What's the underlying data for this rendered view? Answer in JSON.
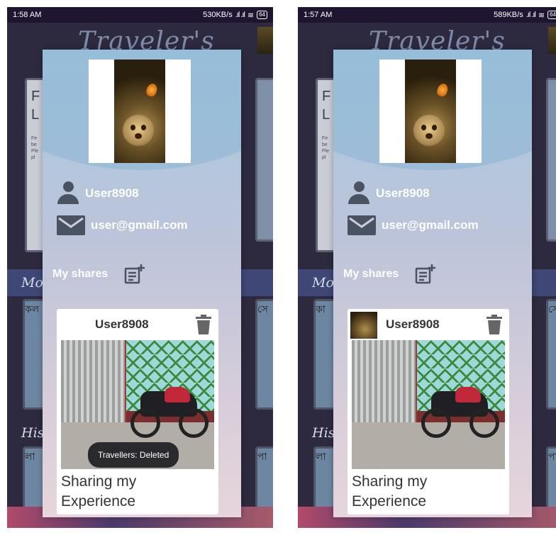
{
  "screens": [
    {
      "status": {
        "time": "1:58 AM",
        "net_speed": "530KB/s",
        "battery": "64"
      },
      "app_title": "Traveler's",
      "background": {
        "card_title": "F\nL",
        "card_text": "Fe\nbe\nPle\npl",
        "section_1": "Mo",
        "section_2": "His",
        "tile_1": "কল",
        "tile_2": "সে",
        "tile_3": "লা",
        "tile_4": "পা"
      },
      "drawer": {
        "username": "User8908",
        "email": "user@gmail.com",
        "my_shares_label": "My shares",
        "post": {
          "username": "User8908",
          "caption": "Sharing my Experience",
          "show_avatar": false
        }
      },
      "toast": "Travellers: Deleted"
    },
    {
      "status": {
        "time": "1:57 AM",
        "net_speed": "589KB/s",
        "battery": "64"
      },
      "app_title": "Traveler's",
      "background": {
        "card_title": "F\nL",
        "card_text": "Fe\nbe\nPle\npl",
        "section_1": "Mo",
        "section_2": "His",
        "tile_1": "কা",
        "tile_2": "সে",
        "tile_3": "লা",
        "tile_4": "পা"
      },
      "drawer": {
        "username": "User8908",
        "email": "user@gmail.com",
        "my_shares_label": "My shares",
        "post": {
          "username": "User8908",
          "caption": "Sharing my Experience",
          "show_avatar": true
        }
      },
      "toast": ""
    }
  ],
  "icons": {
    "user": "user-icon",
    "mail": "mail-icon",
    "add_post": "add-post-icon",
    "trash": "trash-icon"
  },
  "colors": {
    "icon_gray": "#4b5362",
    "toast_bg": "#2a2a2e",
    "card_bg": "#ffffff"
  }
}
